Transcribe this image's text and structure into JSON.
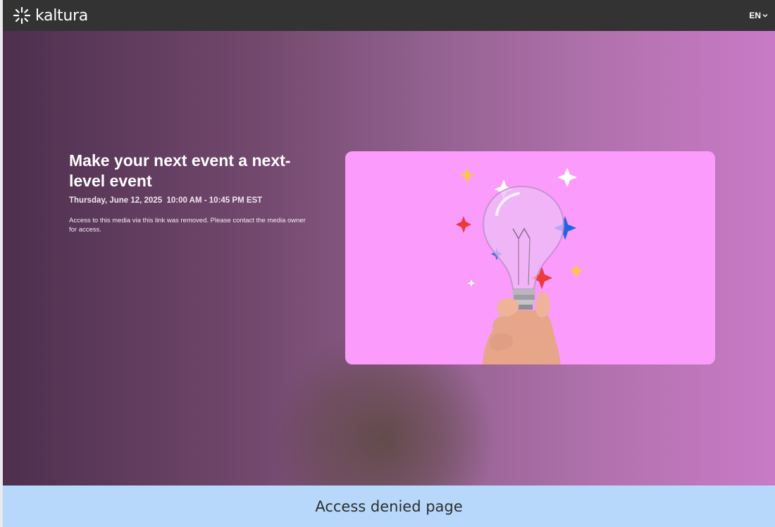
{
  "header": {
    "logo_text": "kaltura",
    "logo_icon": "kaltura-sparkle-icon",
    "language": "EN",
    "language_icon": "chevron-down-icon"
  },
  "event": {
    "title": "Make your next event a next-level event",
    "date": "Thursday, June 12, 2025",
    "time": "10:00 AM - 10:45 PM EST",
    "message": "Access to this media via this link was removed. Please contact the media owner for access.",
    "thumbnail_icon": "lightbulb-in-hand-image"
  },
  "footer": {
    "caption": "Access denied page"
  },
  "colors": {
    "topbar": "#333333",
    "hero_start": "#4e2f4d",
    "hero_end": "#c97ac6",
    "thumbnail_bg": "#fb9bfb",
    "footer_bg": "#b7d8fb"
  }
}
